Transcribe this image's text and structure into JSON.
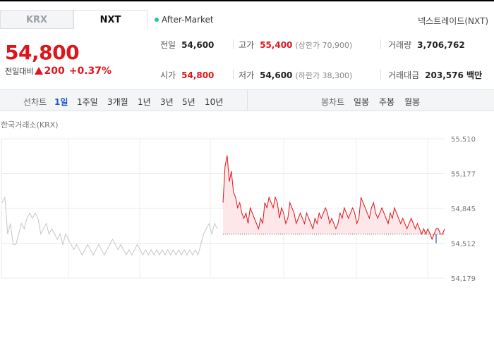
{
  "tabs": {
    "krx": "KRX",
    "nxt": "NXT"
  },
  "after_market": "After-Market",
  "nxt_link": "넥스트레이드(NXT)",
  "price": "54,800",
  "change": {
    "label": "전일대비",
    "amount": "200",
    "pct": "+0.37%"
  },
  "stats": {
    "prev_label": "전일",
    "prev": "54,600",
    "high_label": "고가",
    "high": "55,400",
    "upper_limit": "(상한가 70,900)",
    "volume_label": "거래량",
    "volume": "3,706,762",
    "open_label": "시가",
    "open": "54,800",
    "low_label": "저가",
    "low": "54,600",
    "lower_limit": "(하한가 38,300)",
    "value_label": "거래대금",
    "value": "203,576 백만"
  },
  "periods": {
    "line_label": "선차트",
    "line": [
      "1일",
      "1주일",
      "3개월",
      "1년",
      "3년",
      "5년",
      "10년"
    ],
    "candle_label": "봉차트",
    "candle": [
      "일봉",
      "주봉",
      "월봉"
    ]
  },
  "chart_title": "한국거래소(KRX)",
  "colors": {
    "up": "#e0151b",
    "down": "#1f58c6",
    "fill": "#fde7e8",
    "krx_line": "#c4c6ca"
  },
  "chart_data": {
    "type": "line",
    "ylim": [
      54179,
      55510
    ],
    "yticks": [
      "55,510",
      "55,177",
      "54,845",
      "54,512",
      "54,179"
    ],
    "prev_close": 54600,
    "series": [
      {
        "values": [
          54900,
          54950,
          54600,
          54700,
          54500,
          54500,
          54600,
          54700,
          54650,
          54750,
          54800,
          54750,
          54800,
          54750,
          54600,
          54650,
          54700,
          54600,
          54650,
          54600,
          54550,
          54600,
          54500,
          54600,
          54550,
          54500,
          54450,
          54500,
          54450,
          54400,
          54450,
          54500,
          54450,
          54400,
          54450,
          54500,
          54450,
          54400,
          54450,
          54500,
          54550,
          54500,
          54450,
          54500,
          54450,
          54400,
          54450,
          54400,
          54450,
          54500,
          54450,
          54400,
          54450,
          54400,
          54450,
          54400,
          54450,
          54400,
          54450,
          54400,
          54450,
          54400,
          54450,
          54400,
          54450,
          54400,
          54450,
          54400,
          54450,
          54400,
          54450,
          54400,
          54500,
          54600,
          54650,
          54700,
          54600,
          54700,
          54650
        ]
      },
      {
        "values": [
          54900,
          55250,
          55350,
          55100,
          55200,
          55000,
          54950,
          54850,
          54900,
          54800,
          54750,
          54800,
          54700,
          54850,
          54800,
          54750,
          54700,
          54650,
          54750,
          54700,
          54900,
          54850,
          54950,
          54900,
          54850,
          54950,
          54900,
          54750,
          54850,
          54800,
          54700,
          54750,
          54900,
          54850,
          54800,
          54700,
          54750,
          54800,
          54750,
          54700,
          54800,
          54750,
          54700,
          54650,
          54750,
          54700,
          54800,
          54750,
          54800,
          54850,
          54800,
          54700,
          54750,
          54700,
          54650,
          54700,
          54800,
          54750,
          54850,
          54800,
          54750,
          54800,
          54850,
          54800,
          54700,
          54750,
          54950,
          54900,
          54850,
          54800,
          54750,
          54850,
          54900,
          54800,
          54750,
          54800,
          54850,
          54800,
          54750,
          54700,
          54800,
          54750,
          54850,
          54800,
          54750,
          54700,
          54750,
          54700,
          54650,
          54700,
          54750,
          54700,
          54650,
          54700,
          54650,
          54600,
          54650,
          54600,
          54650,
          54600,
          54550,
          54600,
          54650,
          54650,
          54600,
          54600,
          54650
        ]
      }
    ]
  }
}
